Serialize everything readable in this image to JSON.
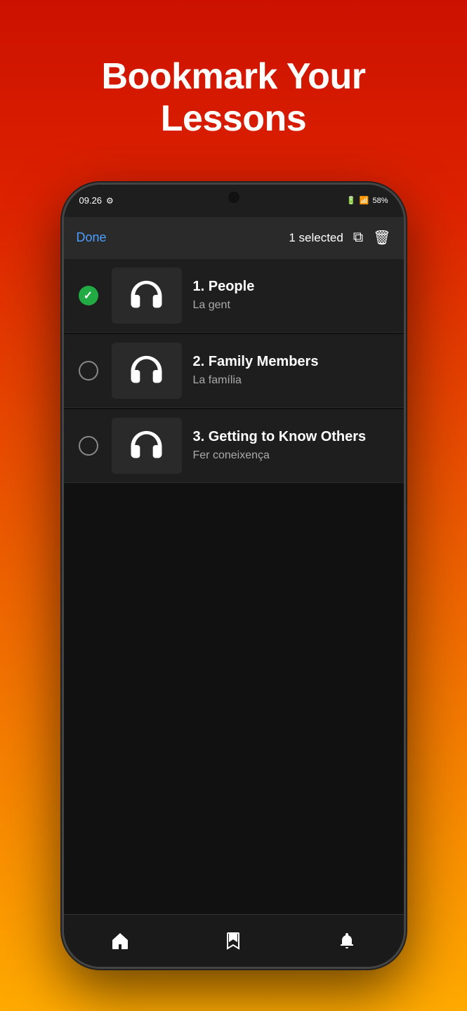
{
  "page": {
    "title_line1": "Bookmark Your",
    "title_line2": "Lessons"
  },
  "status_bar": {
    "time": "09.26",
    "battery": "58%"
  },
  "top_bar": {
    "done_label": "Done",
    "selected_count": "1 selected"
  },
  "lessons": [
    {
      "id": 1,
      "number": "1.",
      "title": "People",
      "subtitle": "La gent",
      "selected": true
    },
    {
      "id": 2,
      "number": "2.",
      "title": "Family Members",
      "subtitle": "La família",
      "selected": false
    },
    {
      "id": 3,
      "number": "3.",
      "title": "Getting to Know Others",
      "subtitle": "Fer coneixença",
      "selected": false
    }
  ],
  "bottom_nav": {
    "home_label": "home",
    "bookmark_label": "bookmark",
    "notifications_label": "notifications"
  }
}
